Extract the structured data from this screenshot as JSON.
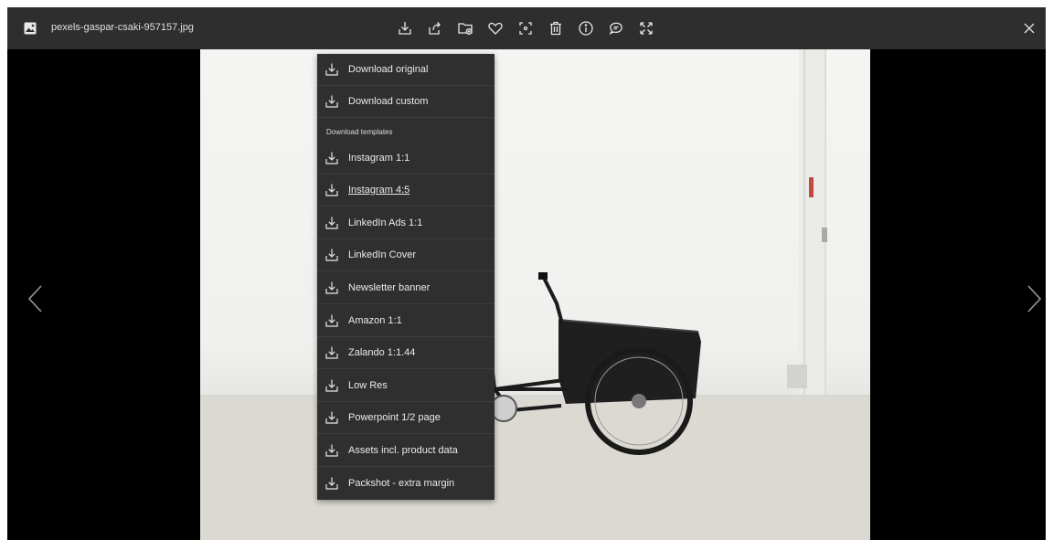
{
  "header": {
    "filename": "pexels-gaspar-csaki-957157.jpg"
  },
  "toolbar": {
    "icons": [
      "download-icon",
      "share-icon",
      "add-to-folder-icon",
      "heart-icon",
      "crop-icon",
      "trash-icon",
      "info-icon",
      "comment-icon",
      "fullscreen-icon"
    ]
  },
  "download_menu": {
    "items_top": [
      {
        "label": "Download original"
      },
      {
        "label": "Download custom"
      }
    ],
    "section_title": "Download templates",
    "templates": [
      {
        "label": "Instagram 1:1"
      },
      {
        "label": "Instagram 4:5"
      },
      {
        "label": "LinkedIn Ads 1:1"
      },
      {
        "label": "LinkedIn Cover"
      },
      {
        "label": "Newsletter banner"
      },
      {
        "label": "Amazon 1:1"
      },
      {
        "label": "Zalando 1:1.44"
      },
      {
        "label": "Low Res"
      },
      {
        "label": "Powerpoint 1/2 page"
      },
      {
        "label": "Assets incl. product data"
      },
      {
        "label": "Packshot - extra margin"
      }
    ],
    "hovered_item": "Instagram 4:5"
  },
  "colors": {
    "topbar": "#2e2e2e",
    "menu": "#2f2f2f",
    "backdrop": "#000000"
  }
}
